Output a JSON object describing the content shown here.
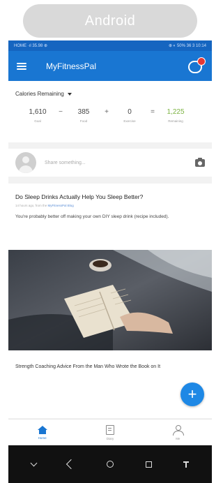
{
  "os_label": "Android",
  "statusbar": {
    "left": "HOME ·ıl 35.98 ⊕",
    "right": "⊕ ◐ 50% 36 3 10:14"
  },
  "appbar": {
    "title": "MyFitnessPal"
  },
  "calories": {
    "header": "Calories Remaining",
    "goal": {
      "value": "1,610",
      "label": "Goal"
    },
    "food": {
      "value": "385",
      "label": "Food"
    },
    "exercise": {
      "value": "0",
      "label": "Exercise"
    },
    "remaining": {
      "value": "1,225",
      "label": "Remaining"
    },
    "ops": [
      "−",
      "+",
      "="
    ]
  },
  "share": {
    "placeholder": "Share something..."
  },
  "article": {
    "title": "Do Sleep Drinks Actually Help You Sleep Better?",
    "meta_prefix": "14 hours ago, from the ",
    "meta_source": "MyFitnessPal Blog",
    "description": "You're probably better off making your own DIY sleep drink (recipe included)."
  },
  "second_article": {
    "title": "Strength Coaching Advice From the Man Who Wrote the Book on It"
  },
  "bottom_nav": {
    "items": [
      {
        "label": "Home",
        "icon": "home-icon",
        "active": true
      },
      {
        "label": "Diary",
        "icon": "diary-icon",
        "active": false
      },
      {
        "label": "Me",
        "icon": "me-icon",
        "active": false
      }
    ]
  },
  "colors": {
    "brand": "#1976d2",
    "remaining": "#7cb342",
    "fab": "#1e88e5",
    "badge": "#e53935"
  },
  "system_nav": [
    "chevron-down-icon",
    "back-icon",
    "home-circle-icon",
    "recents-icon",
    "pin-icon"
  ]
}
